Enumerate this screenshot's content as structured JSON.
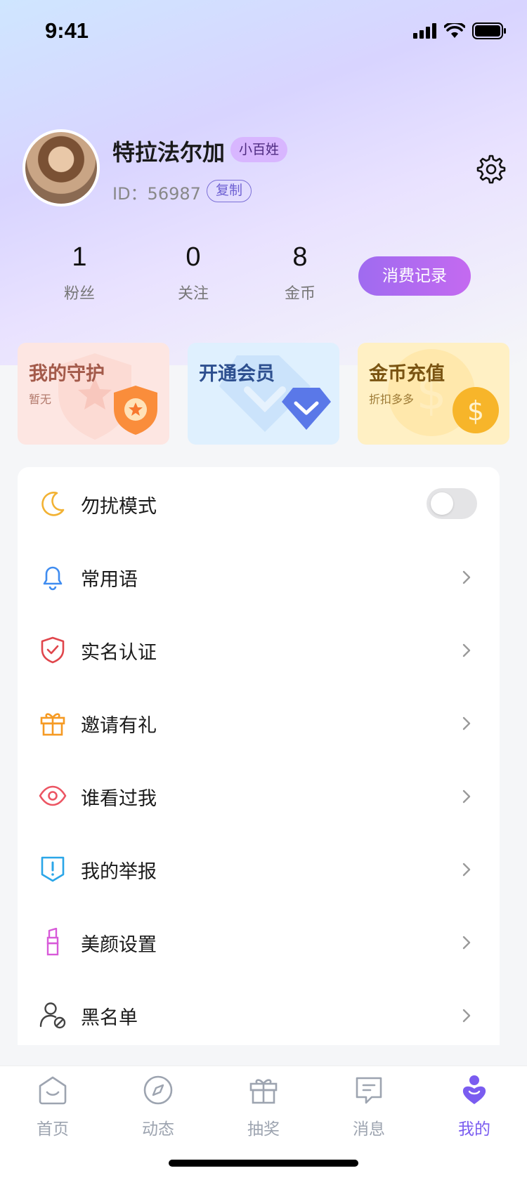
{
  "status_bar": {
    "time": "9:41"
  },
  "profile": {
    "name": "特拉法尔加",
    "level_badge": "小百姓",
    "id_text": "ID：56987",
    "copy_label": "复制"
  },
  "stats": [
    {
      "value": "1",
      "label": "粉丝"
    },
    {
      "value": "0",
      "label": "关注"
    },
    {
      "value": "8",
      "label": "金币"
    }
  ],
  "record_button": "消费记录",
  "cards": [
    {
      "title": "我的守护",
      "subtitle": "暂无",
      "title_color": "#a35a4a"
    },
    {
      "title": "开通会员",
      "subtitle": "",
      "title_color": "#2d4f8f"
    },
    {
      "title": "金币充值",
      "subtitle": "折扣多多",
      "title_color": "#7a5412"
    }
  ],
  "menu": {
    "dnd": {
      "label": "勿扰模式",
      "icon": "moon-icon",
      "enabled": false
    },
    "items": [
      {
        "label": "常用语",
        "icon": "bell-icon"
      },
      {
        "label": "实名认证",
        "icon": "shield-check-icon"
      },
      {
        "label": "邀请有礼",
        "icon": "gift-icon"
      },
      {
        "label": "谁看过我",
        "icon": "eye-icon"
      },
      {
        "label": "我的举报",
        "icon": "report-icon"
      },
      {
        "label": "美颜设置",
        "icon": "lipstick-icon"
      },
      {
        "label": "黑名单",
        "icon": "blocked-user-icon"
      }
    ]
  },
  "tabs": [
    {
      "label": "首页",
      "icon": "home-icon",
      "active": false
    },
    {
      "label": "动态",
      "icon": "compass-icon",
      "active": false
    },
    {
      "label": "抽奖",
      "icon": "gift-icon",
      "active": false
    },
    {
      "label": "消息",
      "icon": "message-icon",
      "active": false
    },
    {
      "label": "我的",
      "icon": "profile-icon",
      "active": true
    }
  ],
  "colors": {
    "accent": "#7a5cf0",
    "tab_inactive": "#9da4b0"
  }
}
